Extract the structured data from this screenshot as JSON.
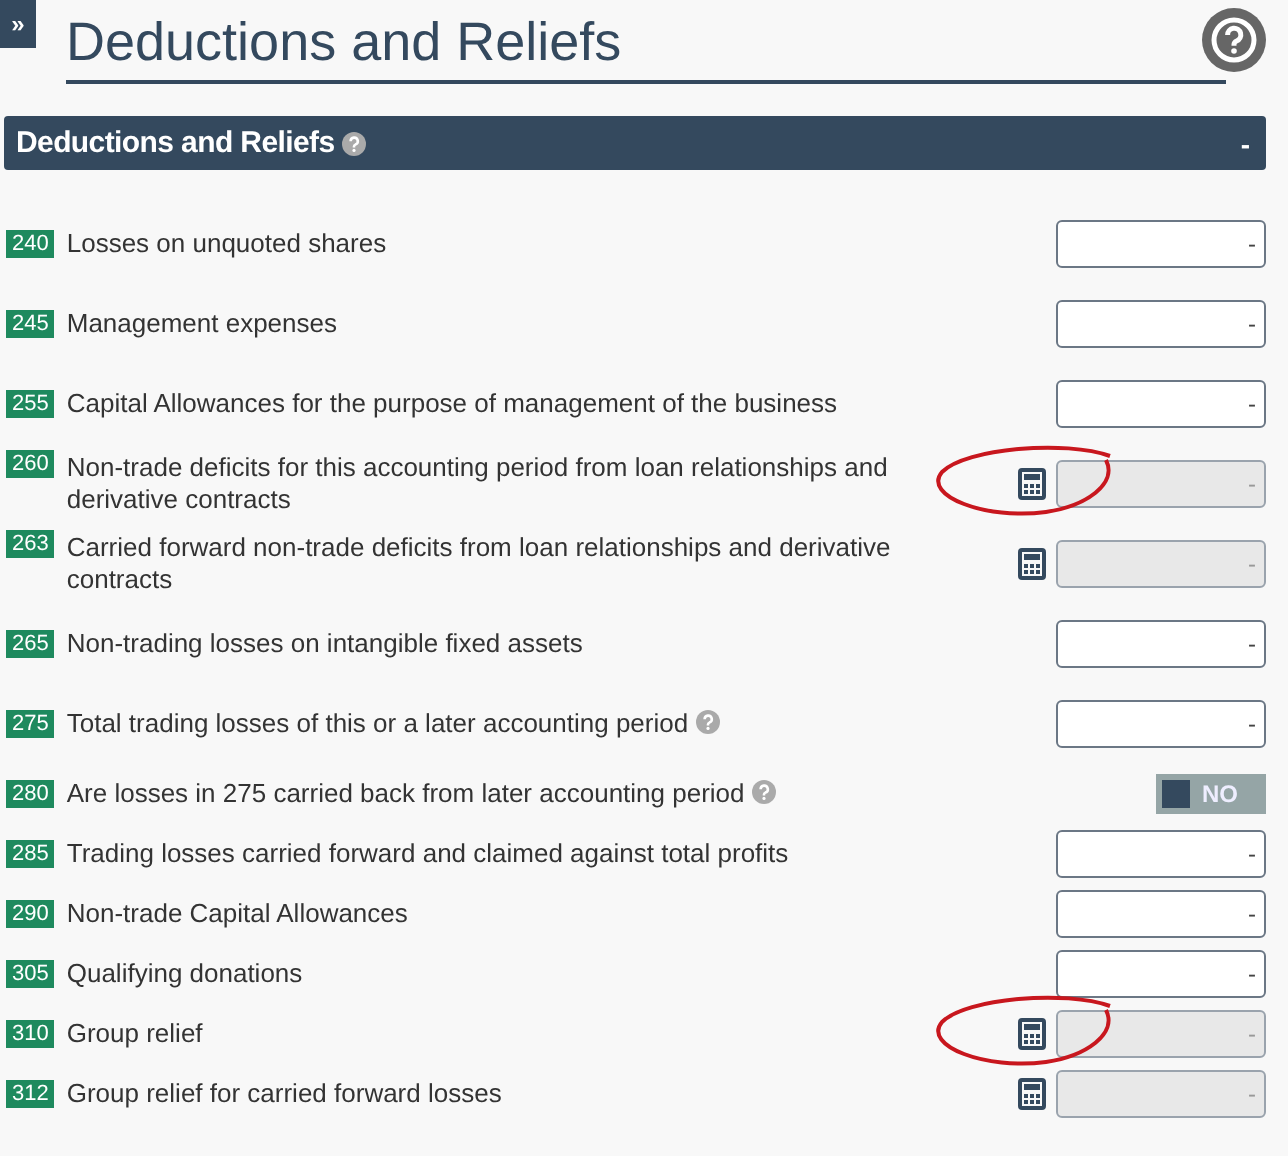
{
  "sidebar_toggle": "»",
  "title": "Deductions and Reliefs",
  "section": {
    "title": "Deductions and Reliefs",
    "collapse": "-",
    "expanded": true
  },
  "rows": [
    {
      "code": "240",
      "label": "Losses on unquoted shares",
      "kind": "input",
      "value": "-",
      "disabled": false,
      "help": false,
      "highlighted": false
    },
    {
      "code": "245",
      "label": "Management expenses",
      "kind": "input",
      "value": "-",
      "disabled": false,
      "help": false,
      "highlighted": false
    },
    {
      "code": "255",
      "label": "Capital Allowances for the purpose of management of the business",
      "kind": "input",
      "value": "-",
      "disabled": false,
      "help": false,
      "highlighted": false
    },
    {
      "code": "260",
      "label": "Non-trade deficits for this accounting period from loan relationships and derivative contracts",
      "kind": "calculated",
      "value": "-",
      "disabled": true,
      "help": false,
      "highlighted": true
    },
    {
      "code": "263",
      "label": "Carried forward non-trade deficits from loan relationships and derivative contracts",
      "kind": "calculated",
      "value": "-",
      "disabled": true,
      "help": false,
      "highlighted": false
    },
    {
      "code": "265",
      "label": "Non-trading losses on intangible fixed assets",
      "kind": "input",
      "value": "-",
      "disabled": false,
      "help": false,
      "highlighted": false
    },
    {
      "code": "275",
      "label": "Total trading losses of this or a later accounting period",
      "kind": "input",
      "value": "-",
      "disabled": false,
      "help": true,
      "highlighted": false
    },
    {
      "code": "280",
      "label": "Are losses in 275 carried back from later accounting period",
      "kind": "toggle",
      "value": "NO",
      "on": false,
      "help": true,
      "highlighted": false
    },
    {
      "code": "285",
      "label": "Trading losses carried forward and claimed against total profits",
      "kind": "input",
      "value": "-",
      "disabled": false,
      "help": false,
      "highlighted": false
    },
    {
      "code": "290",
      "label": "Non-trade Capital Allowances",
      "kind": "input",
      "value": "-",
      "disabled": false,
      "help": false,
      "highlighted": false
    },
    {
      "code": "305",
      "label": "Qualifying donations",
      "kind": "input",
      "value": "-",
      "disabled": false,
      "help": false,
      "highlighted": false
    },
    {
      "code": "310",
      "label": "Group relief",
      "kind": "calculated",
      "value": "-",
      "disabled": true,
      "help": false,
      "highlighted": true
    },
    {
      "code": "312",
      "label": "Group relief for carried forward losses",
      "kind": "calculated",
      "value": "-",
      "disabled": true,
      "help": false,
      "highlighted": false
    }
  ]
}
